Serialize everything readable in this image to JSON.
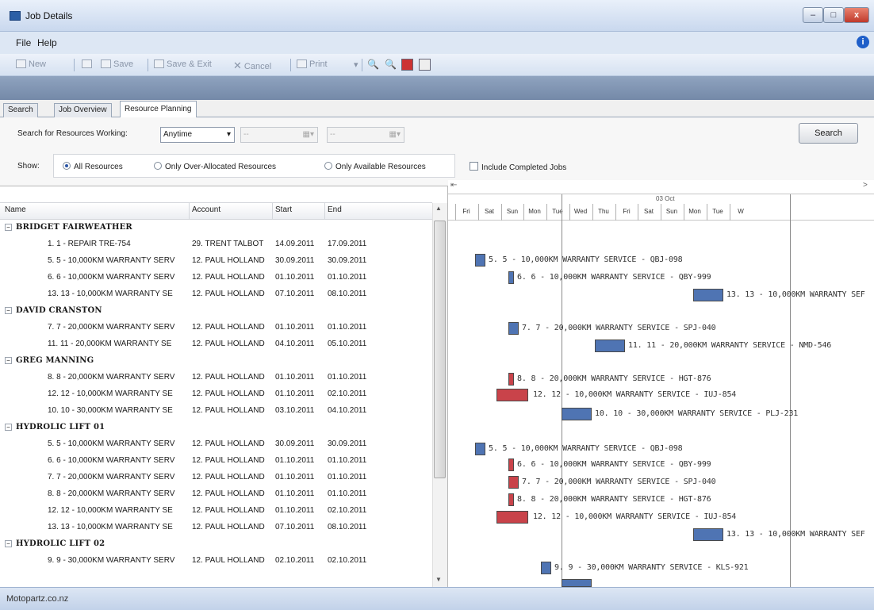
{
  "window": {
    "title": "Job Details",
    "min": "–",
    "max": "□",
    "close": "x"
  },
  "menu": {
    "file": "File",
    "help": "Help",
    "info": "i"
  },
  "toolbar": {
    "new": "New",
    "save": "Save",
    "save_exit": "Save & Exit",
    "cancel": "Cancel",
    "print": "Print"
  },
  "tabs": [
    "Search",
    "Job Overview",
    "Resource Planning"
  ],
  "filters": {
    "search_label": "Search for Resources Working:",
    "when_value": "Anytime",
    "date_from": "--",
    "date_to": "--",
    "search_button": "Search",
    "show_label": "Show:",
    "radio_all": "All Resources",
    "radio_over": "Only Over-Allocated Resources",
    "radio_avail": "Only Available Resources",
    "include_completed": "Include Completed Jobs"
  },
  "grid": {
    "columns": [
      "Name",
      "Account",
      "Start",
      "End"
    ],
    "groups": [
      {
        "name": "BRIDGET FAIRWEATHER",
        "rows": [
          {
            "name": "1. 1 - REPAIR TRE-754",
            "account": "29. TRENT TALBOT",
            "start": "14.09.2011",
            "end": "17.09.2011"
          },
          {
            "name": "5. 5 - 10,000KM WARRANTY SERV",
            "account": "12. PAUL HOLLAND",
            "start": "30.09.2011",
            "end": "30.09.2011"
          },
          {
            "name": "6. 6 - 10,000KM WARRANTY SERV",
            "account": "12. PAUL HOLLAND",
            "start": "01.10.2011",
            "end": "01.10.2011"
          },
          {
            "name": "13. 13 - 10,000KM WARRANTY SE",
            "account": "12. PAUL HOLLAND",
            "start": "07.10.2011",
            "end": "08.10.2011"
          }
        ]
      },
      {
        "name": "DAVID CRANSTON",
        "rows": [
          {
            "name": "7. 7 - 20,000KM WARRANTY SERV",
            "account": "12. PAUL HOLLAND",
            "start": "01.10.2011",
            "end": "01.10.2011"
          },
          {
            "name": "11. 11 - 20,000KM WARRANTY SE",
            "account": "12. PAUL HOLLAND",
            "start": "04.10.2011",
            "end": "05.10.2011"
          }
        ]
      },
      {
        "name": "GREG MANNING",
        "rows": [
          {
            "name": "8. 8 - 20,000KM WARRANTY SERV",
            "account": "12. PAUL HOLLAND",
            "start": "01.10.2011",
            "end": "01.10.2011"
          },
          {
            "name": "12. 12 - 10,000KM WARRANTY SE",
            "account": "12. PAUL HOLLAND",
            "start": "01.10.2011",
            "end": "02.10.2011"
          },
          {
            "name": "10. 10 - 30,000KM WARRANTY SE",
            "account": "12. PAUL HOLLAND",
            "start": "03.10.2011",
            "end": "04.10.2011"
          }
        ]
      },
      {
        "name": "HYDROLIC LIFT 01",
        "rows": [
          {
            "name": "5. 5 - 10,000KM WARRANTY SERV",
            "account": "12. PAUL HOLLAND",
            "start": "30.09.2011",
            "end": "30.09.2011"
          },
          {
            "name": "6. 6 - 10,000KM WARRANTY SERV",
            "account": "12. PAUL HOLLAND",
            "start": "01.10.2011",
            "end": "01.10.2011"
          },
          {
            "name": "7. 7 - 20,000KM WARRANTY SERV",
            "account": "12. PAUL HOLLAND",
            "start": "01.10.2011",
            "end": "01.10.2011"
          },
          {
            "name": "8. 8 - 20,000KM WARRANTY SERV",
            "account": "12. PAUL HOLLAND",
            "start": "01.10.2011",
            "end": "01.10.2011"
          },
          {
            "name": "12. 12 - 10,000KM WARRANTY SE",
            "account": "12. PAUL HOLLAND",
            "start": "01.10.2011",
            "end": "02.10.2011"
          },
          {
            "name": "13. 13 - 10,000KM WARRANTY SE",
            "account": "12. PAUL HOLLAND",
            "start": "07.10.2011",
            "end": "08.10.2011"
          }
        ]
      },
      {
        "name": "HYDROLIC LIFT 02",
        "rows": [
          {
            "name": "9. 9 - 30,000KM WARRANTY SERV",
            "account": "12. PAUL HOLLAND",
            "start": "02.10.2011",
            "end": "02.10.2011"
          }
        ]
      }
    ]
  },
  "gantt": {
    "week_label": "03 Oct",
    "days": [
      "Fri",
      "Sat",
      "Sun",
      "Mon",
      "Tue",
      "Wed",
      "Thu",
      "Fri",
      "Sat",
      "Sun",
      "Mon",
      "Tue",
      "W"
    ],
    "bars": [
      {
        "label": "5. 5 - 10,000KM WARRANTY SERVICE - QBJ-098",
        "color": "#4f74b3"
      },
      {
        "label": "6. 6 - 10,000KM WARRANTY SERVICE - QBY-999",
        "color": "#4f74b3"
      },
      {
        "label": "13. 13 - 10,000KM WARRANTY SEF",
        "color": "#4f74b3"
      },
      {
        "label": "7. 7 - 20,000KM WARRANTY SERVICE - SPJ-040",
        "color": "#4f74b3"
      },
      {
        "label": "11. 11 - 20,000KM WARRANTY SERVICE - NMD-546",
        "color": "#4f74b3"
      },
      {
        "label": "8. 8 - 20,000KM WARRANTY SERVICE - HGT-876",
        "color": "#c9434a"
      },
      {
        "label": "12. 12 - 10,000KM WARRANTY SERVICE - IUJ-854",
        "color": "#c9434a"
      },
      {
        "label": "10. 10 - 30,000KM WARRANTY SERVICE - PLJ-231",
        "color": "#4f74b3"
      },
      {
        "label": "5. 5 - 10,000KM WARRANTY SERVICE - QBJ-098",
        "color": "#4f74b3"
      },
      {
        "label": "6. 6 - 10,000KM WARRANTY SERVICE - QBY-999",
        "color": "#c9434a"
      },
      {
        "label": "7. 7 - 20,000KM WARRANTY SERVICE - SPJ-040",
        "color": "#c9434a"
      },
      {
        "label": "8. 8 - 20,000KM WARRANTY SERVICE - HGT-876",
        "color": "#c9434a"
      },
      {
        "label": "12. 12 - 10,000KM WARRANTY SERVICE - IUJ-854",
        "color": "#c9434a"
      },
      {
        "label": "13. 13 - 10,000KM WARRANTY SEF",
        "color": "#4f74b3"
      },
      {
        "label": "9. 9 - 30,000KM WARRANTY SERVICE - KLS-921",
        "color": "#4f74b3"
      }
    ]
  },
  "status": {
    "text": "Motopartz.co.nz"
  }
}
